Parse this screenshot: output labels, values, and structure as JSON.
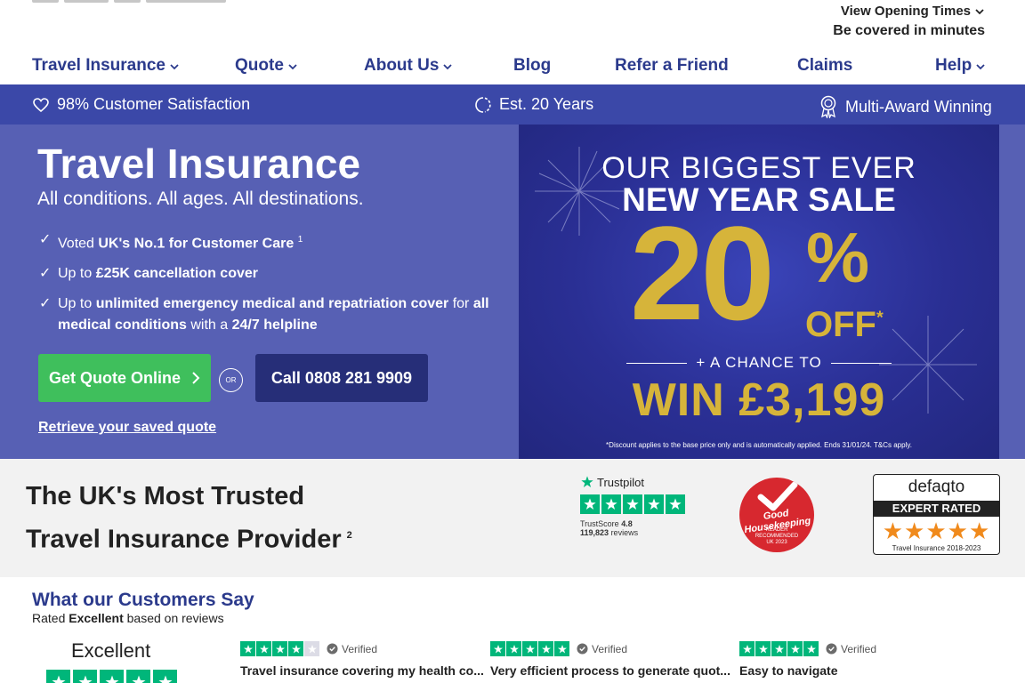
{
  "header": {
    "opening_times": "View Opening Times",
    "covered": "Be covered in minutes"
  },
  "nav": {
    "items": [
      {
        "label": "Travel Insurance"
      },
      {
        "label": "Quote"
      },
      {
        "label": "About Us"
      },
      {
        "label": "Blog"
      },
      {
        "label": "Refer a Friend"
      },
      {
        "label": "Claims"
      },
      {
        "label": "Help"
      }
    ]
  },
  "usp": {
    "satisfaction": "98% Customer Satisfaction",
    "established": "Est. 20 Years",
    "award": "Multi-Award Winning"
  },
  "hero": {
    "title": "Travel Insurance",
    "subtitle": "All conditions. All ages. All destinations.",
    "bullet1_pre": "Voted ",
    "bullet1_bold": "UK's No.1 for Customer Care",
    "bullet1_sup": "1",
    "bullet2_pre": "Up to ",
    "bullet2_bold": "£25K cancellation cover",
    "bullet3_pre": "Up to ",
    "bullet3_bold1": "unlimited emergency medical and repatriation cover",
    "bullet3_mid1": " for ",
    "bullet3_bold2": "all medical conditions",
    "bullet3_mid2": " with a ",
    "bullet3_bold3": "24/7 helpline",
    "quote_button": "Get Quote Online",
    "or": "OR",
    "call_button": "Call 0808 281 9909",
    "retrieve_link": "Retrieve your saved quote"
  },
  "promo": {
    "line1": "OUR BIGGEST EVER",
    "line2": "NEW YEAR SALE",
    "big_number": "20",
    "percent": "%",
    "off": "OFF",
    "off_mark": "*",
    "chance": "+ A CHANCE TO",
    "win": "WIN £3,199",
    "fine_print": "*Discount applies to the base price only and is automatically applied.  Ends 31/01/24.  T&Cs apply."
  },
  "trusted": {
    "title_line1": "The UK's Most Trusted",
    "title_line2": "Travel Insurance Provider",
    "title_sup": "2",
    "trustpilot_name": "Trustpilot",
    "trustscore_label": "TrustScore",
    "trustscore_value": "4.8",
    "review_count": "119,823",
    "reviews_label": "reviews",
    "gh_brand": "Good Housekeeping",
    "gh_line1": "READER",
    "gh_line2": "RECOMMENDED",
    "gh_line3": "UK 2023",
    "defaqto_name": "defaqto",
    "defaqto_rating": "EXPERT RATED",
    "defaqto_stars": "★★★★★",
    "defaqto_years": "Travel Insurance 2018-2023"
  },
  "reviews": {
    "title": "What our Customers Say",
    "rated_pre": "Rated ",
    "rated_bold": "Excellent",
    "rated_post": " based on reviews",
    "summary_label": "Excellent",
    "summary_stars": 5,
    "cards": [
      {
        "verified": "Verified",
        "text": "Travel insurance covering my health co...",
        "stars": 4
      },
      {
        "verified": "Verified",
        "text": "Very efficient process to generate quot...",
        "stars": 5
      },
      {
        "verified": "Verified",
        "text": "Easy to navigate",
        "stars": 5
      }
    ]
  },
  "colors": {
    "nav_text": "#2b3a8c",
    "usp_strip": "#3b48a8",
    "hero_bg": "#5760b4",
    "quote_button": "#3fbf5c",
    "call_button": "#262e78",
    "promo_gold": "#d6b43a",
    "trustpilot_green": "#00b67a",
    "good_housekeeping_red": "#d7282f",
    "defaqto_stars": "#f08a1c"
  },
  "icons": [
    "chevron-down-icon",
    "heart-icon",
    "loading-circle-icon",
    "award-rosette-icon",
    "chevron-right-icon",
    "check-icon",
    "trustpilot-star-icon",
    "verified-check-icon"
  ]
}
